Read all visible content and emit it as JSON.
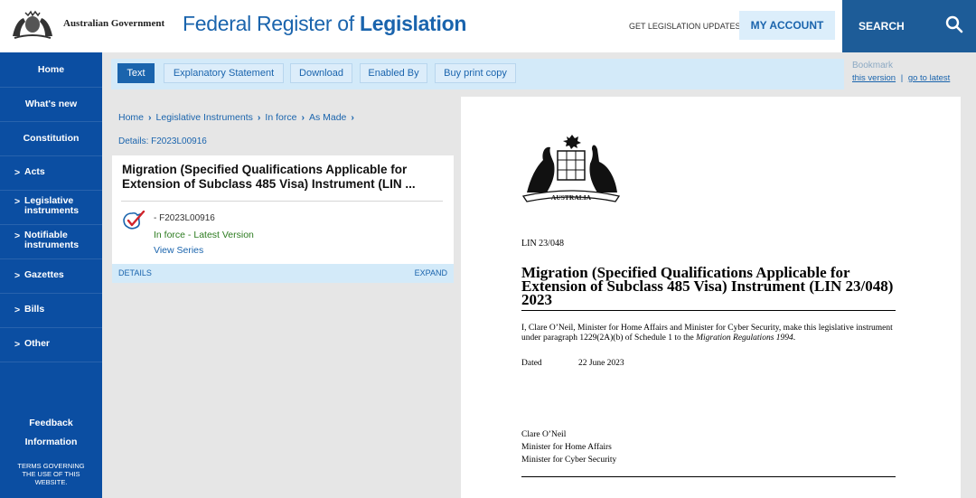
{
  "header": {
    "gov_label": "Australian Government",
    "site_title_prefix": "Federal Register of ",
    "site_title_bold": "Legislation",
    "get_updates": "GET LEGISLATION UPDATES",
    "my_account": "MY ACCOUNT",
    "search": "SEARCH"
  },
  "sidebar": {
    "items": [
      {
        "label": "Home",
        "arrow": ""
      },
      {
        "label": "What's new",
        "arrow": ""
      },
      {
        "label": "Constitution",
        "arrow": ""
      },
      {
        "label": "Acts",
        "arrow": ">"
      },
      {
        "label": "Legislative instruments",
        "arrow": ">"
      },
      {
        "label": "Notifiable instruments",
        "arrow": ">"
      },
      {
        "label": "Gazettes",
        "arrow": ">"
      },
      {
        "label": "Bills",
        "arrow": ">"
      },
      {
        "label": "Other",
        "arrow": ">"
      }
    ],
    "feedback": "Feedback",
    "information": "Information",
    "terms": "TERMS GOVERNING THE USE OF THIS WEBSITE."
  },
  "toolbar": {
    "tabs": [
      "Text",
      "Explanatory Statement",
      "Download",
      "Enabled By",
      "Buy print copy"
    ],
    "active_tab": "Text",
    "bookmark": "Bookmark",
    "this_version": "this version",
    "divider": "|",
    "go_to_latest": "go to latest"
  },
  "breadcrumb": {
    "items": [
      "Home",
      "Legislative Instruments",
      "In force",
      "As Made"
    ],
    "separator": "›"
  },
  "details_id": "Details: F2023L00916",
  "card": {
    "title": "Migration (Specified Qualifications Applicable for Extension of Subclass 485 Visa) Instrument (LIN ...",
    "id": "- F2023L00916",
    "status": "In force - Latest Version",
    "view_series": "View Series",
    "details": "DETAILS",
    "expand": "EXPAND"
  },
  "document": {
    "crest_label": "AUSTRALIA",
    "ref": "LIN 23/048",
    "title": "Migration (Specified Qualifications Applicable for Extension of Subclass 485 Visa) Instrument (LIN 23/048) 2023",
    "body_pre": "I, Clare O’Neil, Minister for Home Affairs and Minister for Cyber Security, make this legislative instrument under paragraph 1229(2A)(b) of Schedule 1 to the ",
    "body_italic": "Migration Regulations 1994",
    "body_post": ".",
    "dated_label": "Dated",
    "dated_value": "22 June 2023",
    "signatory": "Clare O’Neil",
    "role1": "Minister for Home Affairs",
    "role2": "Minister for Cyber Security"
  },
  "colors": {
    "brand_blue": "#1a64ad",
    "sidebar_blue": "#0b4ea2",
    "search_bg": "#1d5c98",
    "toolbar_bg": "#d3eaf9",
    "status_green": "#2c7b1f"
  }
}
